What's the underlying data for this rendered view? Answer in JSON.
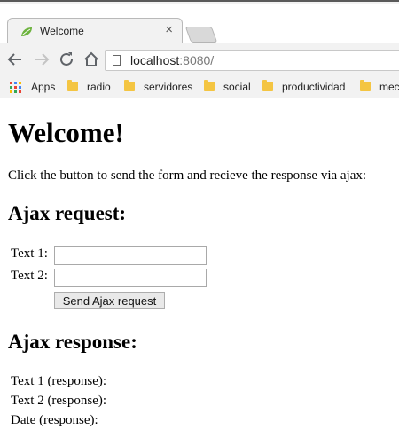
{
  "browser": {
    "tab": {
      "title": "Welcome",
      "close": "×"
    },
    "address": {
      "host": "localhost",
      "port": ":8080/"
    },
    "bookmarks": [
      {
        "label": "Apps",
        "icon": "apps-grid-icon"
      },
      {
        "label": "radio",
        "icon": "folder-icon"
      },
      {
        "label": "servidores",
        "icon": "folder-icon"
      },
      {
        "label": "social",
        "icon": "folder-icon"
      },
      {
        "label": "productividad",
        "icon": "folder-icon"
      },
      {
        "label": "mec",
        "icon": "folder-icon"
      }
    ]
  },
  "page": {
    "heading": "Welcome!",
    "intro": "Click the button to send the form and recieve the response via ajax:",
    "request": {
      "heading": "Ajax request:",
      "text1_label": "Text 1:",
      "text1_value": "",
      "text2_label": "Text 2:",
      "text2_value": "",
      "button_label": "Send Ajax request"
    },
    "response": {
      "heading": "Ajax response:",
      "text1_label": "Text 1 (response):",
      "text2_label": "Text 2 (response):",
      "date_label": "Date (response):"
    }
  },
  "colors": {
    "folder": "#f4c542",
    "leaf": "#6db33f",
    "port_text": "#777777"
  }
}
